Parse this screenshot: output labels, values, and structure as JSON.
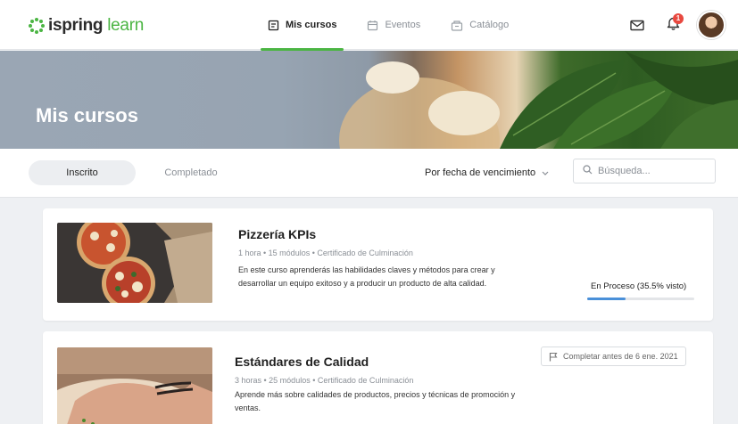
{
  "brand": {
    "name": "ispring",
    "name_accent": "learn",
    "accent_color": "#4bb543"
  },
  "nav": {
    "items": [
      {
        "label": "Mis cursos",
        "icon": "book-icon",
        "active": true
      },
      {
        "label": "Eventos",
        "icon": "calendar-icon",
        "active": false
      },
      {
        "label": "Catálogo",
        "icon": "catalog-icon",
        "active": false
      }
    ]
  },
  "header_icons": {
    "mail": "mail-icon",
    "notifications": "bell-icon",
    "notification_count": "1"
  },
  "hero": {
    "title": "Mis cursos"
  },
  "filters": {
    "tabs": [
      {
        "label": "Inscrito",
        "active": true
      },
      {
        "label": "Completado",
        "active": false
      }
    ],
    "sort_label": "Por fecha de vencimiento",
    "search_placeholder": "Búsqueda..."
  },
  "courses": [
    {
      "title": "Pizzería KPIs",
      "meta": "1 hora  •  15 módulos  •  Certificado de Culminación",
      "description": "En este curso aprenderás las habilidades claves y métodos para crear y desarrollar un equipo exitoso y a producir un producto de alta calidad.",
      "status": "En Proceso (35.5% visto)",
      "progress": 0.355,
      "progress_color": "#4a90d9"
    },
    {
      "title": "Estándares de Calidad",
      "meta": "3 horas  •  25 módulos  •  Certificado de Culminación",
      "description": "Aprende más sobre calidades de productos, precios y técnicas de promoción y ventas.",
      "deadline": "Completar antes de 6 ene. 2021"
    }
  ]
}
